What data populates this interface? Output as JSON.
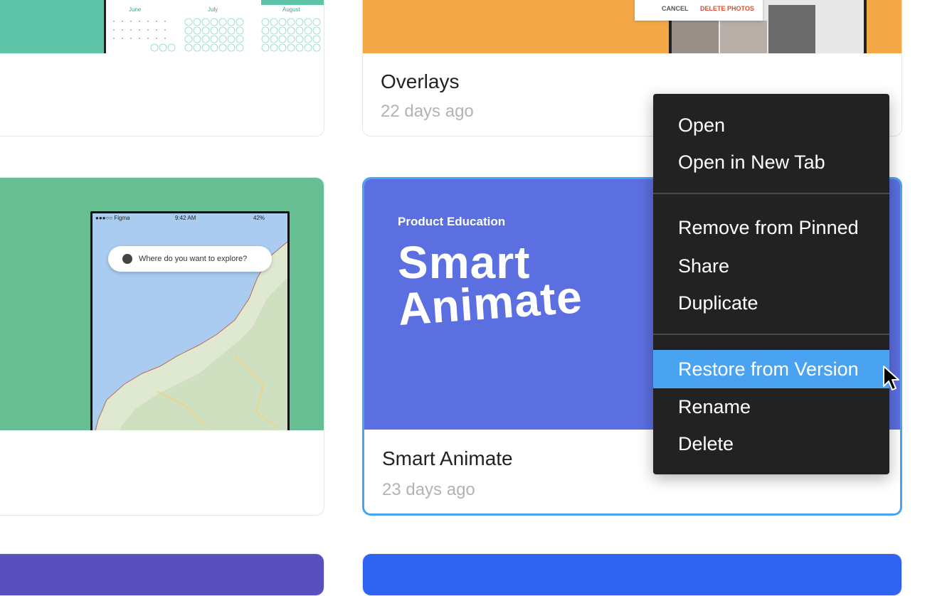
{
  "cards": {
    "overlays": {
      "title": "Overlays",
      "time": "22 days ago",
      "cancel": "CANCEL",
      "delete": "DELETE PHOTOS"
    },
    "smart_animate": {
      "title": "Smart Animate",
      "time": "23 days ago",
      "eyebrow": "Product Education",
      "headline_1": "Smart",
      "headline_2": "Animate"
    },
    "calendar": {
      "months": [
        "June",
        "July",
        "August"
      ]
    },
    "map": {
      "carrier": "●●●○○ Figma",
      "time": "9:42 AM",
      "battery": "42%",
      "search": "Where do you want to explore?"
    }
  },
  "context_menu": {
    "items": [
      "Open",
      "Open in New Tab",
      "Remove from Pinned",
      "Share",
      "Duplicate",
      "Restore from Version",
      "Rename",
      "Delete"
    ],
    "active_index": 5
  },
  "colors": {
    "teal": "#5ec4a8",
    "orange": "#f4a845",
    "green": "#67be93",
    "indigo": "#5b6fe0",
    "menu_bg": "#222222",
    "highlight": "#4aa3f0",
    "selection": "#4aa3f0"
  }
}
